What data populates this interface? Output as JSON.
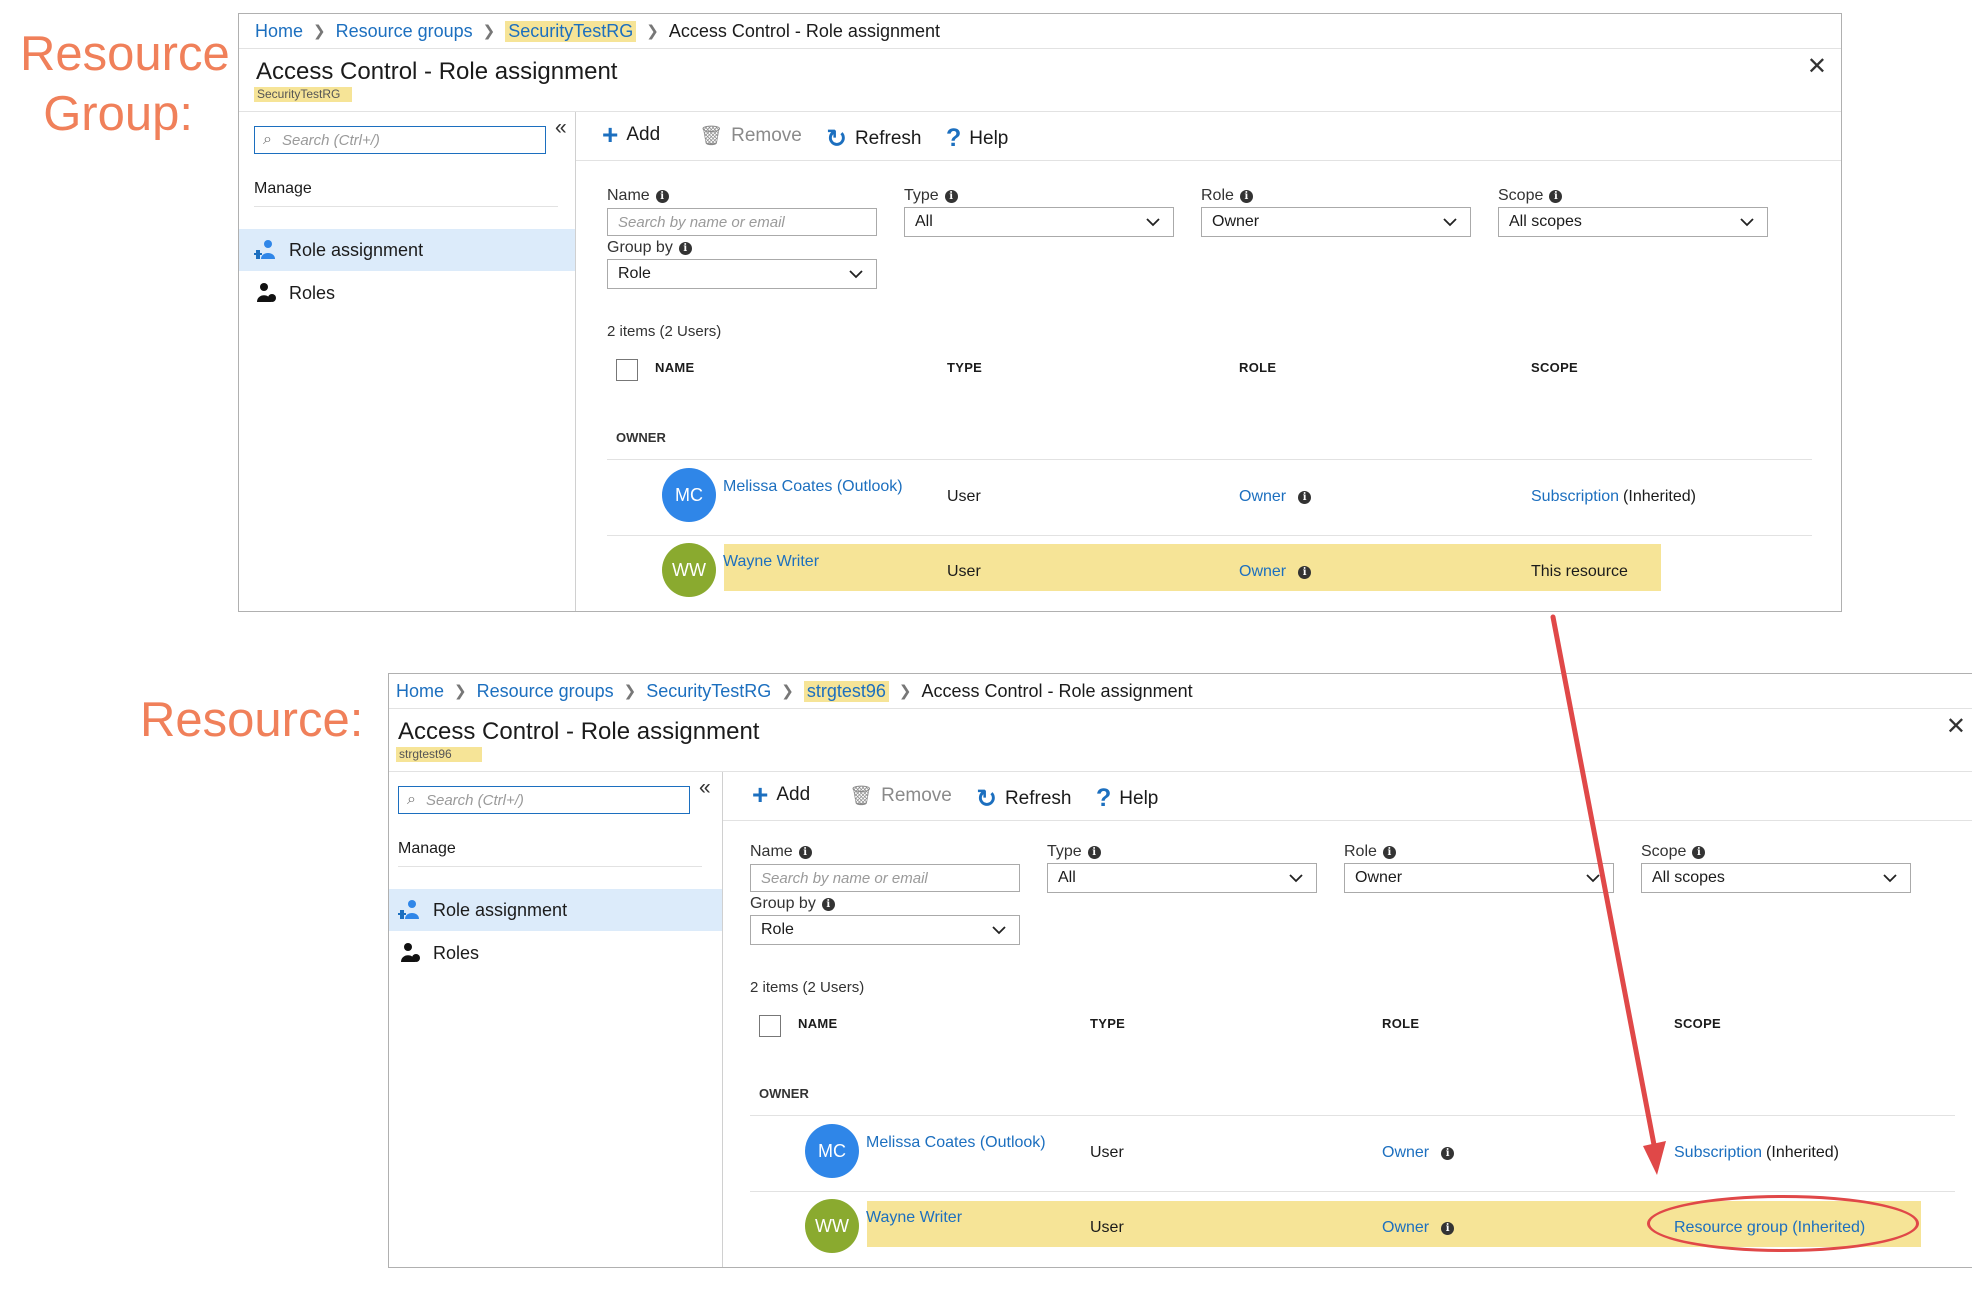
{
  "labels": {
    "top": "Resource\nGroup:",
    "bottom": "Resource:"
  },
  "top_panel": {
    "breadcrumb": [
      "Home",
      "Resource groups",
      "SecurityTestRG",
      "Access Control - Role assignment"
    ],
    "title": "Access Control - Role assignment",
    "subtitle": "SecurityTestRG",
    "search_placeholder": "Search (Ctrl+/)",
    "manage_label": "Manage",
    "nav": [
      "Role assignment",
      "Roles"
    ],
    "toolbar": {
      "add": "Add",
      "remove": "Remove",
      "refresh": "Refresh",
      "help": "Help"
    },
    "filters": {
      "name_label": "Name",
      "name_placeholder": "Search by name or email",
      "type_label": "Type",
      "type_value": "All",
      "role_label": "Role",
      "role_value": "Owner",
      "scope_label": "Scope",
      "scope_value": "All scopes",
      "groupby_label": "Group by",
      "groupby_value": "Role"
    },
    "items_count": "2 items (2 Users)",
    "columns": [
      "NAME",
      "TYPE",
      "ROLE",
      "SCOPE"
    ],
    "group": "OWNER",
    "rows": [
      {
        "initials": "MC",
        "name": "Melissa Coates (Outlook)",
        "type": "User",
        "role": "Owner",
        "scope_link": "Subscription",
        "scope_suffix": "(Inherited)"
      },
      {
        "initials": "WW",
        "name": "Wayne Writer",
        "type": "User",
        "role": "Owner",
        "scope_text": "This resource"
      }
    ]
  },
  "bottom_panel": {
    "breadcrumb": [
      "Home",
      "Resource groups",
      "SecurityTestRG",
      "strgtest96",
      "Access Control - Role assignment"
    ],
    "title": "Access Control - Role assignment",
    "subtitle": "strgtest96",
    "search_placeholder": "Search (Ctrl+/)",
    "manage_label": "Manage",
    "nav": [
      "Role assignment",
      "Roles"
    ],
    "toolbar": {
      "add": "Add",
      "remove": "Remove",
      "refresh": "Refresh",
      "help": "Help"
    },
    "filters": {
      "name_label": "Name",
      "name_placeholder": "Search by name or email",
      "type_label": "Type",
      "type_value": "All",
      "role_label": "Role",
      "role_value": "Owner",
      "scope_label": "Scope",
      "scope_value": "All scopes",
      "groupby_label": "Group by",
      "groupby_value": "Role"
    },
    "items_count": "2 items (2 Users)",
    "columns": [
      "NAME",
      "TYPE",
      "ROLE",
      "SCOPE"
    ],
    "group": "OWNER",
    "rows": [
      {
        "initials": "MC",
        "name": "Melissa Coates (Outlook)",
        "type": "User",
        "role": "Owner",
        "scope_link": "Subscription",
        "scope_suffix": "(Inherited)"
      },
      {
        "initials": "WW",
        "name": "Wayne Writer",
        "type": "User",
        "role": "Owner",
        "scope_text": "Resource group (Inherited)"
      }
    ]
  },
  "colors": {
    "label": "#f0805a",
    "highlight": "#f6e497",
    "link": "#1c6fbf",
    "annotation": "#e04848",
    "avatar_mc": "#2f86e8",
    "avatar_ww": "#8aaa2f"
  }
}
